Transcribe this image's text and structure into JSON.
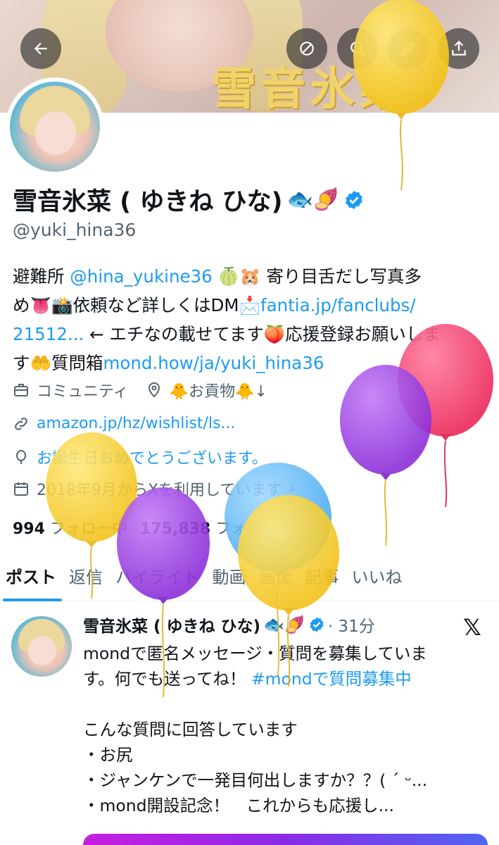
{
  "banner": {
    "title": "雪音氷菜"
  },
  "profile": {
    "display_name": "雪音氷菜 ( ゆきね ひな)",
    "name_emojis": "🐟🍠",
    "handle": "@yuki_hina36",
    "bio_line1_a": "避難所 ",
    "bio_line1_link": "@hina_yukine36",
    "bio_line1_b": " 🍈🐹 寄り目舌だし写真多",
    "bio_line2_a": "め👅📸依頼など詳しくはDM📩",
    "bio_line2_link": "fantia.jp/fanclubs/",
    "bio_line3_link": "21512...",
    "bio_line3_b": " ← エチなの載せてます🍑応援登録お願いしま",
    "bio_line4_a": "す🤲質問箱",
    "bio_line4_link": "mond.how/ja/yuki_hina36",
    "category": "コミュニティ",
    "location": "🐥お貢物🐥↓",
    "website": "amazon.jp/hz/wishlist/ls...",
    "birthday": "お誕生日おめでとうございます。",
    "joined": "2018年9月からXを利用しています",
    "following_count": "994",
    "following_label": "フォロー中",
    "followers_count": "175,838",
    "followers_label": "フォロワー"
  },
  "tabs": [
    {
      "label": "ポスト",
      "active": true
    },
    {
      "label": "返信",
      "active": false
    },
    {
      "label": "ハイライト",
      "active": false
    },
    {
      "label": "動画",
      "active": false
    },
    {
      "label": "画像",
      "active": false
    },
    {
      "label": "記事",
      "active": false
    },
    {
      "label": "いいね",
      "active": false
    }
  ],
  "tweet": {
    "name": "雪音氷菜 ( ゆきね ひな)",
    "name_emojis": "🐟🍠",
    "time": "· 31分",
    "source_logo": "𝕏",
    "line1": "mondで匿名メッセージ・質問を募集していま",
    "line2_a": "す。何でも送ってね！ ",
    "line2_tag": "#mondで質問募集中",
    "line3": "こんな質問に回答しています",
    "line4": "・お尻",
    "line5": "・ジャンケンで一発目何出しますか？？( ´ ᵕ...",
    "line6": "・mond開設記念！　これからも応援し..."
  },
  "colors": {
    "accent": "#1d9bf0",
    "text": "#0f1419",
    "secondary": "#536471",
    "balloon_yellow": "#f7cf2b",
    "balloon_purple": "#9b3fe3",
    "balloon_pink": "#f23e6e",
    "balloon_blue": "#58b8f5"
  },
  "icons": {
    "back": "arrow-left-icon",
    "no_sync": "circle-slash-icon",
    "search": "search-icon",
    "edit": "pencil-icon",
    "share": "share-upload-icon",
    "category": "briefcase-icon",
    "location": "location-pin-icon",
    "website": "link-icon",
    "birthday": "balloon-icon",
    "joined": "calendar-icon",
    "verified": "verified-badge-icon"
  }
}
